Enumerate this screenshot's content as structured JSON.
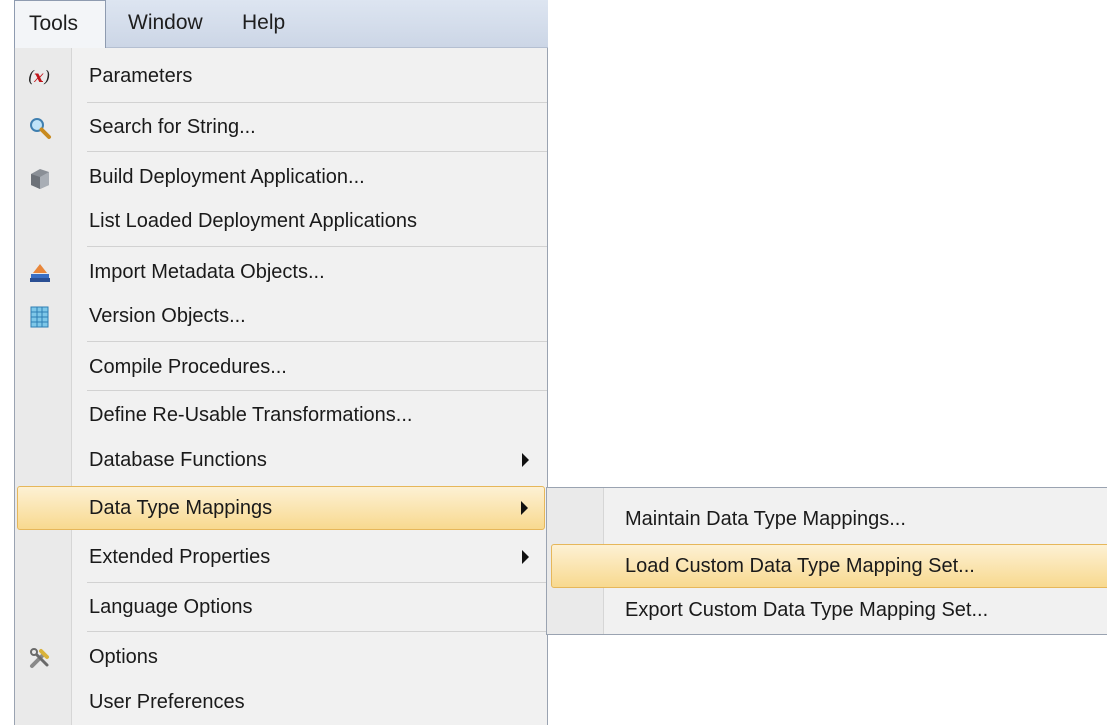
{
  "menubar": {
    "items": [
      {
        "label": "Tools"
      },
      {
        "label": "Window"
      },
      {
        "label": "Help"
      }
    ]
  },
  "tools_menu": {
    "items": [
      {
        "label": "Parameters",
        "icon": "parameters-icon"
      },
      {
        "label": "Search for String...",
        "icon": "magnifier-icon"
      },
      {
        "label": "Build Deployment Application...",
        "icon": "deployment-icon"
      },
      {
        "label": "List Loaded Deployment Applications"
      },
      {
        "label": "Import Metadata Objects...",
        "icon": "import-icon"
      },
      {
        "label": "Version Objects...",
        "icon": "grid-icon"
      },
      {
        "label": "Compile Procedures..."
      },
      {
        "label": "Define Re-Usable Transformations..."
      },
      {
        "label": "Database Functions",
        "has_submenu": true
      },
      {
        "label": "Data Type Mappings",
        "has_submenu": true,
        "highlighted": true
      },
      {
        "label": "Extended Properties",
        "has_submenu": true
      },
      {
        "label": "Language Options"
      },
      {
        "label": "Options",
        "icon": "tools-icon"
      },
      {
        "label": "User Preferences"
      }
    ]
  },
  "submenu": {
    "items": [
      {
        "label": "Maintain Data Type Mappings..."
      },
      {
        "label": "Load Custom Data Type Mapping Set...",
        "highlighted": true
      },
      {
        "label": "Export Custom Data Type Mapping Set..."
      }
    ]
  },
  "colors": {
    "highlight": "#f8d98f",
    "menu_background": "#f1f1f1",
    "menubar_background": "#d3dcea"
  }
}
